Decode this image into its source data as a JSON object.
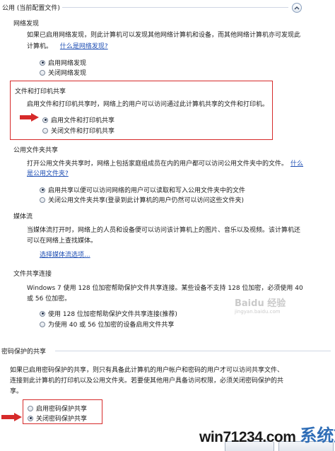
{
  "profile": {
    "title": "公用 (当前配置文件)"
  },
  "network_discovery": {
    "header": "网络发现",
    "desc_line1": "如果已启用网络发现，则此计算机可以发现其他网络计算机和设备，而其他网络计算机亦可发现此",
    "desc_line2": "计算机。",
    "link": "什么是网络发现?",
    "options": [
      "启用网络发现",
      "关闭网络发现"
    ]
  },
  "file_printer": {
    "header": "文件和打印机共享",
    "desc": "启用文件和打印机共享时，网络上的用户可以访问通过此计算机共享的文件和打印机。",
    "options": [
      "启用文件和打印机共享",
      "关闭文件和打印机共享"
    ]
  },
  "public_folder": {
    "header": "公用文件夹共享",
    "desc_line1": "打开公用文件夹共享时，网络上包括家庭组成员在内的用户都可以访问公用文件夹中的文件。",
    "link_part1": "什么",
    "link_part2": "是公用文件夹?",
    "options": [
      "启用共享以便可以访问网络的用户可以读取和写入公用文件夹中的文件",
      "关闭公用文件夹共享(登录到此计算机的用户仍然可以访问这些文件夹)"
    ]
  },
  "media": {
    "header": "媒体流",
    "desc_line1": "当媒体流打开时，网络上的人员和设备便可以访问该计算机上的图片、音乐以及视频。该计算机还",
    "desc_line2": "可以在网络上查找媒体。",
    "link": "选择媒体流选项..."
  },
  "file_share_conn": {
    "header": "文件共享连接",
    "desc_line1": "Windows 7 使用 128 位加密帮助保护文件共享连接。某些设备不支持 128 位加密，必须使用 40",
    "desc_line2": "或 56 位加密。",
    "options": [
      "使用 128 位加密帮助保护文件共享连接(推荐)",
      "为使用 40 或 56 位加密的设备启用文件共享"
    ]
  },
  "password": {
    "header": "密码保护的共享",
    "desc_line1": "如果已启用密码保护的共享，则只有具备此计算机的用户帐户和密码的用户才可以访问共享文件、",
    "desc_line2": "连接到此计算机的打印机以及公用文件夹。若要使其他用户具备访问权限，必须关闭密码保护的共",
    "desc_line3": "享。",
    "options": [
      "启用密码保护共享",
      "关闭密码保护共享"
    ]
  },
  "watermarks": {
    "baidu": "Baidu 经验",
    "baidu_url": "jingyan.baidu.com",
    "site": "win71234.com",
    "site_cn": "系统族"
  },
  "colors": {
    "highlight_box": "#d62a2a",
    "link": "#1f4fb4"
  }
}
